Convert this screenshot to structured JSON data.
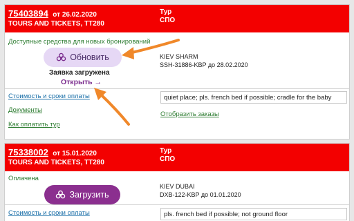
{
  "orders": [
    {
      "number": "75403894",
      "date_text": "от 26.02.2020",
      "agent": "TOURS AND TICKETS, TT280",
      "type_line1": "Тур",
      "type_line2": "СПО",
      "status": "Доступные средства для новых бронирований",
      "action_button": "Обновить",
      "request_status": "Заявка загружена",
      "open_link": "Открыть",
      "open_arrow": "→",
      "hotel_line1": "KIEV SHARM",
      "hotel_line2": "SSH-31886-KBP до 28.02.2020",
      "links": [
        "Стоимость и сроки оплаты",
        "Документы",
        "Как оплатить тур"
      ],
      "note": "quiet place; pls. french bed if possible; cradle for the baby",
      "orders_link": "Отобразить заказы"
    },
    {
      "number": "75338002",
      "date_text": "от 15.01.2020",
      "agent": "TOURS AND TICKETS, TT280",
      "type_line1": "Тур",
      "type_line2": "СПО",
      "status": "Оплачена",
      "action_button": "Загрузить",
      "hotel_line1": "KIEV DUBAI",
      "hotel_line2": "DXB-122-KBP до 01.01.2020",
      "links": [
        "Стоимость и сроки оплаты"
      ],
      "note": "pls. french bed if possible; not ground floor"
    }
  ],
  "icons": {
    "button_icon": "flower-logo-icon",
    "annotation": "orange-arrow"
  },
  "colors": {
    "header_red": "#f30000",
    "refresh_button_bg": "#e6d8f5",
    "load_button_bg": "#8b2f8f",
    "status_green": "#2e7d32",
    "link_blue": "#1a6fa8",
    "accent_purple": "#7b2d8e",
    "annotation_orange": "#f0882a"
  }
}
